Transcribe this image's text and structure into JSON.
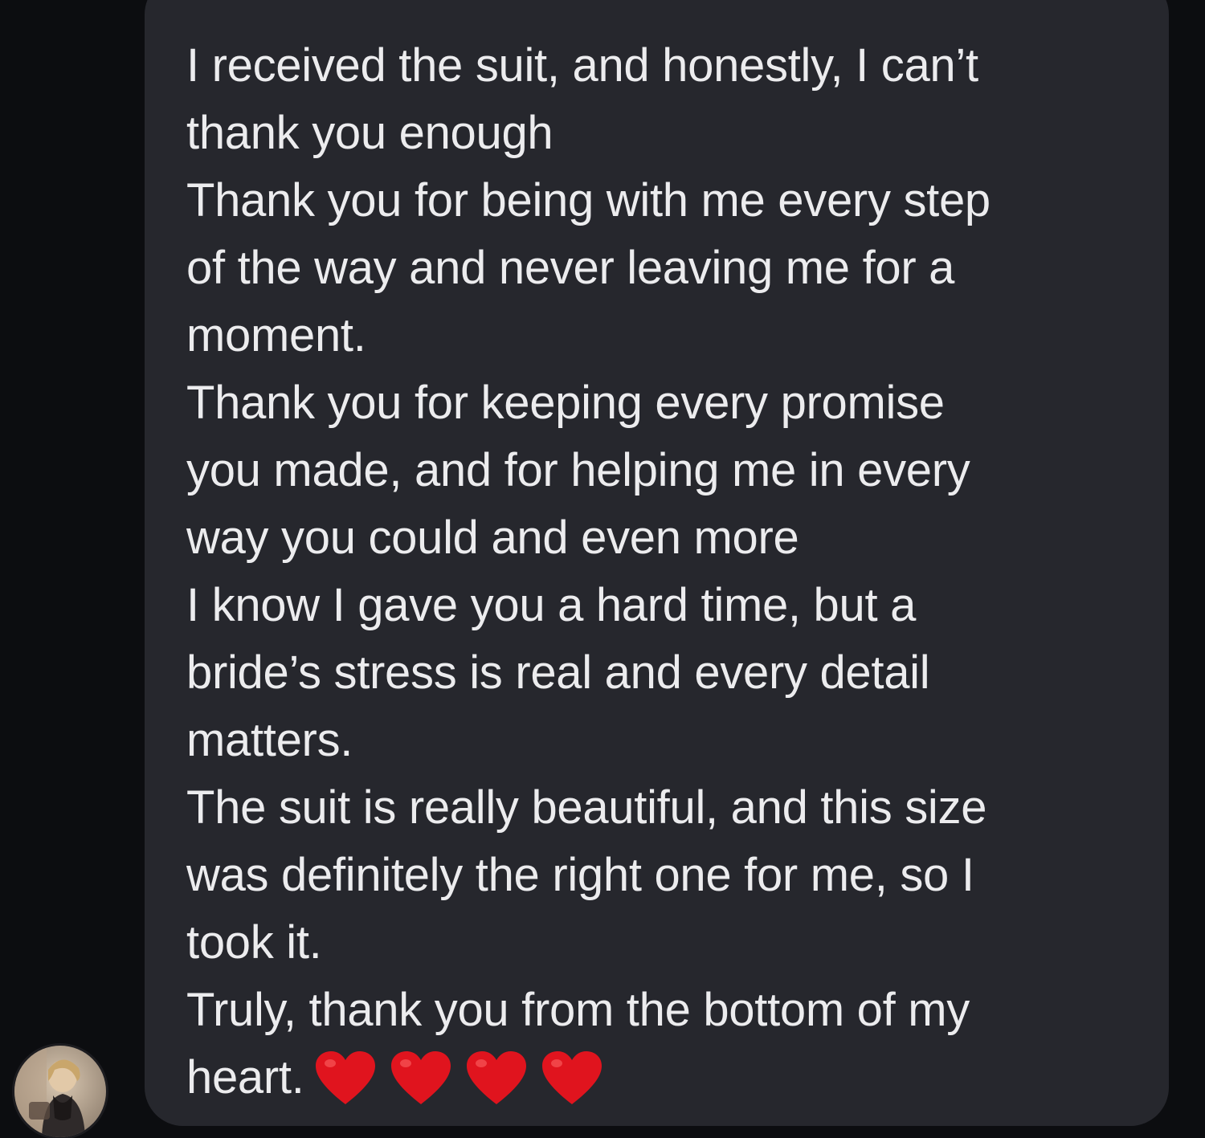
{
  "message": {
    "lines": [
      "I  received the suit, and honestly, I can’t",
      "thank you enough",
      "Thank you for being with me every step",
      "of the way and never leaving me for a",
      "moment.",
      "Thank you for keeping every promise",
      "you made, and for helping me in every",
      "way you could and even more",
      "I know I gave you a hard time, but a",
      "bride’s stress is real and every detail",
      "matters.",
      "The suit is really beautiful, and this size",
      "was definitely the right one for me, so I",
      "took it.",
      "Truly, thank you from the bottom of my",
      "heart."
    ],
    "emoji": [
      "red-heart",
      "red-heart",
      "red-heart",
      "red-heart"
    ]
  },
  "sender": {
    "avatar_icon": "user-avatar"
  },
  "colors": {
    "background": "#0c0d10",
    "bubble": "#26272d",
    "text": "#ececee",
    "heart": "#e0141e"
  }
}
